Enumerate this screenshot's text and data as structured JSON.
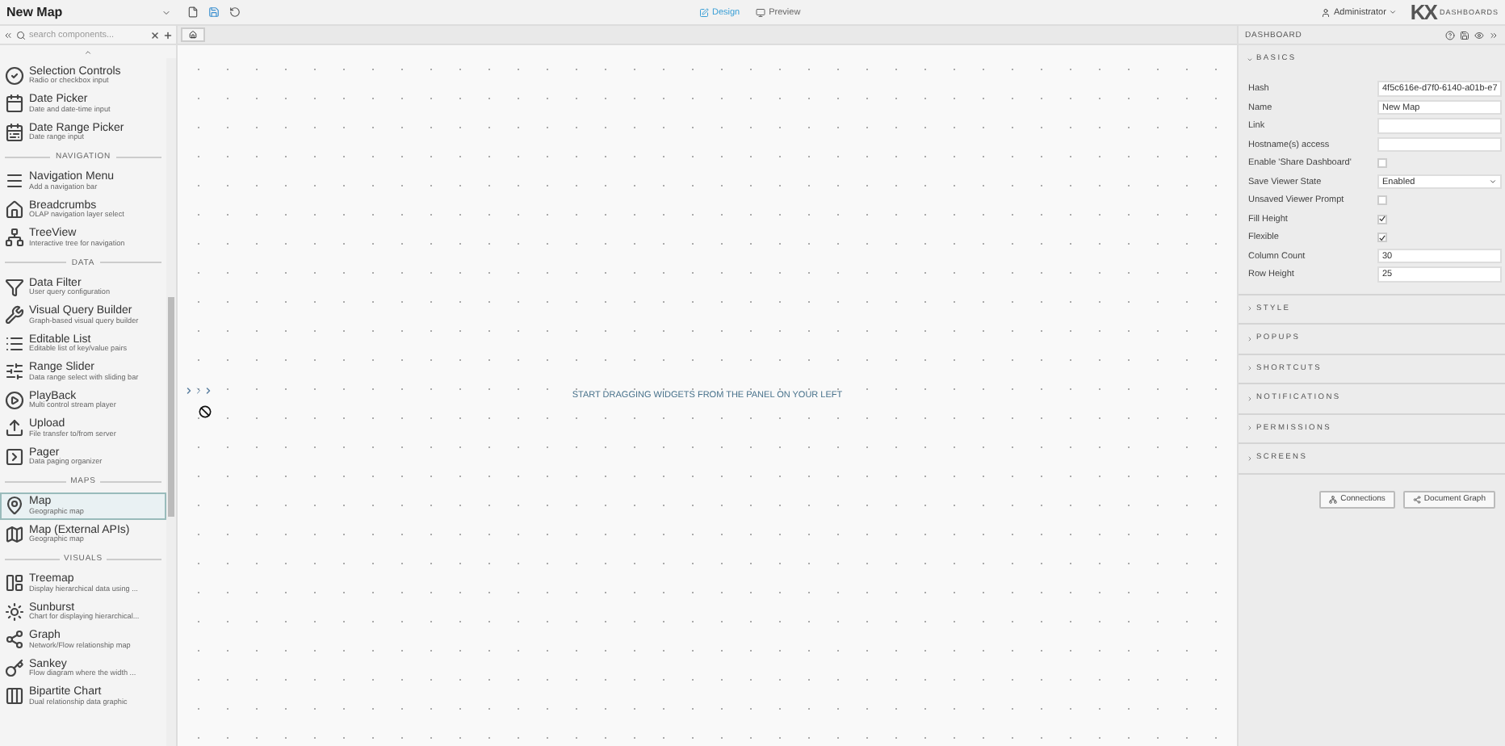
{
  "top_bar": {
    "dashboard_name": "New Map",
    "modes": [
      {
        "label": "Design",
        "selected": true
      },
      {
        "label": "Preview",
        "selected": false
      }
    ],
    "user": "Administrator",
    "logo": "KX",
    "logo_caption": "DASHBOARDS"
  },
  "component_panel": {
    "search": {
      "placeholder": "search components..."
    },
    "items": [
      {
        "kind": "item",
        "title": "Selection Controls",
        "description": "Radio or checkbox input",
        "selected": false
      },
      {
        "kind": "item",
        "title": "Date Picker",
        "description": "Date and date-time input",
        "selected": false
      },
      {
        "kind": "item",
        "title": "Date Range Picker",
        "description": "Date range input",
        "selected": false
      },
      {
        "kind": "header",
        "title": "NAVIGATION"
      },
      {
        "kind": "item",
        "title": "Navigation Menu",
        "description": "Add a navigation bar",
        "selected": false
      },
      {
        "kind": "item",
        "title": "Breadcrumbs",
        "description": "OLAP navigation layer select",
        "selected": false
      },
      {
        "kind": "item",
        "title": "TreeView",
        "description": "Interactive tree for navigation",
        "selected": false
      },
      {
        "kind": "header",
        "title": "DATA"
      },
      {
        "kind": "item",
        "title": "Data Filter",
        "description": "User query configuration",
        "selected": false
      },
      {
        "kind": "item",
        "title": "Visual Query Builder",
        "description": "Graph-based visual query builder",
        "selected": false
      },
      {
        "kind": "item",
        "title": "Editable List",
        "description": "Editable list of key/value pairs",
        "selected": false
      },
      {
        "kind": "item",
        "title": "Range Slider",
        "description": "Data range select with sliding bar",
        "selected": false
      },
      {
        "kind": "item",
        "title": "PlayBack",
        "description": "Multi control stream player",
        "selected": false
      },
      {
        "kind": "item",
        "title": "Upload",
        "description": "File transfer to/from server",
        "selected": false
      },
      {
        "kind": "item",
        "title": "Pager",
        "description": "Data paging organizer",
        "selected": false
      },
      {
        "kind": "header",
        "title": "MAPS"
      },
      {
        "kind": "item",
        "title": "Map",
        "description": "Geographic map",
        "selected": true
      },
      {
        "kind": "item",
        "title": "Map (External APIs)",
        "description": "Geographic map",
        "selected": false
      },
      {
        "kind": "header",
        "title": "VISUALS"
      },
      {
        "kind": "item",
        "title": "Treemap",
        "description": "Display hierarchical data using ...",
        "selected": false
      },
      {
        "kind": "item",
        "title": "Sunburst",
        "description": "Chart for displaying hierarchical...",
        "selected": false
      },
      {
        "kind": "item",
        "title": "Graph",
        "description": "Network/Flow relationship map",
        "selected": false
      },
      {
        "kind": "item",
        "title": "Sankey",
        "description": "Flow diagram where the width ...",
        "selected": false
      },
      {
        "kind": "item",
        "title": "Bipartite Chart",
        "description": "Dual relationship data graphic",
        "selected": false
      }
    ]
  },
  "canvas": {
    "message": "START DRAGGING WIDGETS FROM THE PANEL ON YOUR LEFT"
  },
  "properties": {
    "title": "DASHBOARD",
    "sections": [
      {
        "title": "BASICS",
        "expanded": true,
        "fields": [
          {
            "kind": "text",
            "label": "Hash",
            "value": "4f5c616e-d7f0-6140-a01b-e7"
          },
          {
            "kind": "text",
            "label": "Name",
            "value": "New Map"
          },
          {
            "kind": "text",
            "label": "Link"
          },
          {
            "kind": "text",
            "label": "Hostname(s) access"
          },
          {
            "kind": "checkbox",
            "label": "Enable 'Share Dashboard'",
            "checked": false
          },
          {
            "kind": "select",
            "label": "Save Viewer State",
            "value": "Enabled"
          },
          {
            "kind": "checkbox",
            "label": "Unsaved Viewer Prompt",
            "checked": false
          },
          {
            "kind": "checkbox",
            "label": "Fill Height",
            "checked": true
          },
          {
            "kind": "checkbox",
            "label": "Flexible",
            "checked": true
          },
          {
            "kind": "text",
            "label": "Column Count",
            "value": "30"
          },
          {
            "kind": "text",
            "label": "Row Height",
            "value": "25"
          }
        ]
      },
      {
        "title": "STYLE",
        "expanded": false
      },
      {
        "title": "POPUPS",
        "expanded": false
      },
      {
        "title": "SHORTCUTS",
        "expanded": false
      },
      {
        "title": "NOTIFICATIONS",
        "expanded": false
      },
      {
        "title": "PERMISSIONS",
        "expanded": false
      },
      {
        "title": "SCREENS",
        "expanded": false
      }
    ],
    "buttons": [
      "Connections",
      "Document Graph"
    ]
  }
}
